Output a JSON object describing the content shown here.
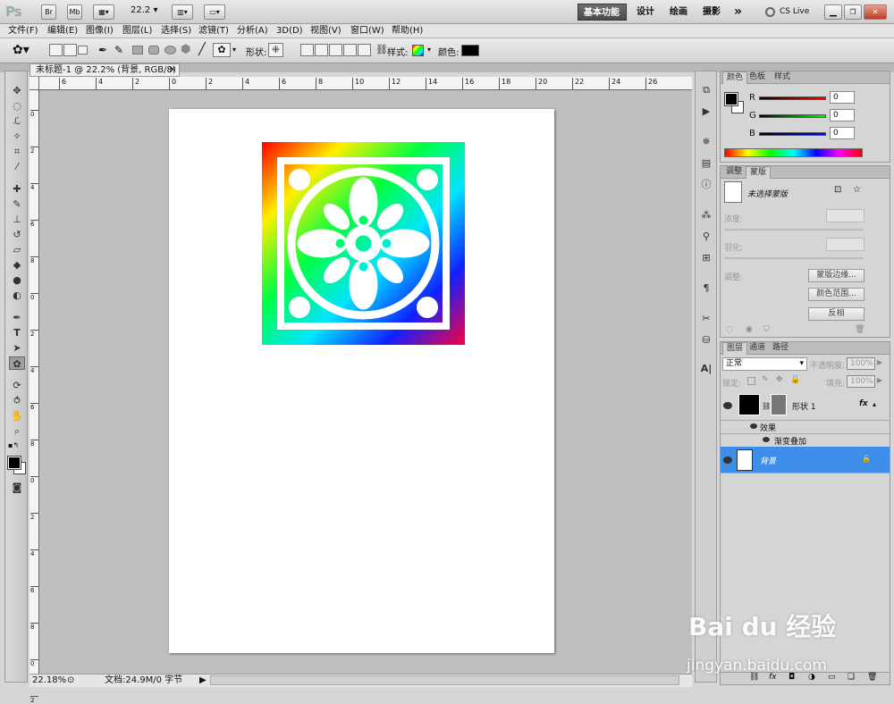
{
  "app": {
    "logo": "Ps",
    "zoom_select": "22.2",
    "workspaces": [
      "基本功能",
      "设计",
      "绘画",
      "摄影"
    ],
    "more": "»",
    "cslive": "CS Live"
  },
  "menu": [
    "文件(F)",
    "编辑(E)",
    "图像(I)",
    "图层(L)",
    "选择(S)",
    "滤镜(T)",
    "分析(A)",
    "3D(D)",
    "视图(V)",
    "窗口(W)",
    "帮助(H)"
  ],
  "options": {
    "shape_label": "形状:",
    "style_label": "样式:",
    "color_label": "颜色:",
    "color_value": "#000000"
  },
  "document": {
    "tab_title": "未标题-1 @ 22.2% (背景, RGB/8) *",
    "ruler_h": [
      "6",
      "4",
      "2",
      "0",
      "2",
      "4",
      "6",
      "8",
      "10",
      "12",
      "14",
      "16",
      "18",
      "20",
      "22",
      "24",
      "26"
    ],
    "ruler_v": [
      "0",
      "2",
      "4",
      "6",
      "8",
      "0",
      "2",
      "4",
      "6",
      "8",
      "0",
      "2",
      "4",
      "6",
      "8",
      "0",
      "2"
    ],
    "zoom": "22.18%",
    "doc_info": "文档:24.9M/0 字节"
  },
  "color_panel": {
    "tabs": [
      "颜色",
      "色板",
      "样式"
    ],
    "channels": [
      {
        "label": "R",
        "value": "0"
      },
      {
        "label": "G",
        "value": "0"
      },
      {
        "label": "B",
        "value": "0"
      }
    ],
    "foreground": "#000000",
    "background": "#ffffff"
  },
  "masks_panel": {
    "tabs": [
      "调整",
      "蒙版"
    ],
    "title": "未选择蒙版",
    "density_label": "浓度:",
    "feather_label": "羽化:",
    "refine_label": "调整:",
    "buttons": [
      "蒙版边缘...",
      "颜色范围...",
      "反相"
    ]
  },
  "layers_panel": {
    "tabs": [
      "图层",
      "通道",
      "路径"
    ],
    "blend_mode": "正常",
    "opacity_label": "不透明度:",
    "opacity": "100%",
    "lock_label": "锁定:",
    "fill_label": "填充:",
    "fill": "100%",
    "layers": [
      {
        "name": "形状 1",
        "fx": "fx"
      },
      {
        "name": "效果"
      },
      {
        "name": "渐变叠加"
      },
      {
        "name": "背景"
      }
    ]
  },
  "watermark": {
    "brand": "Bai du 经验",
    "url": "jingyan.baidu.com"
  }
}
